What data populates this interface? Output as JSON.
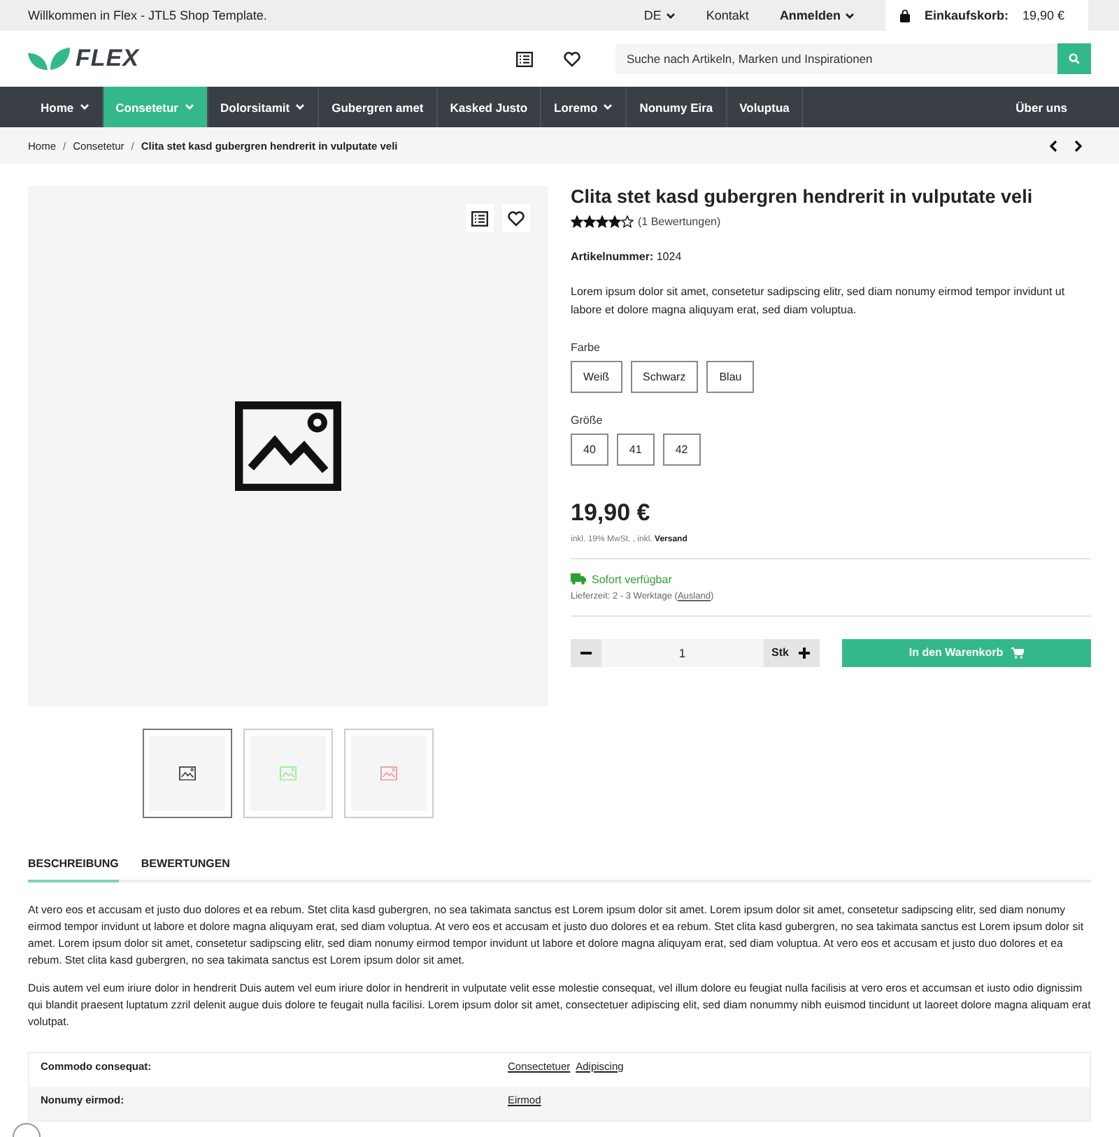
{
  "topbar": {
    "welcome": "Willkommen in Flex - JTL5 Shop Template.",
    "language": "DE",
    "contact": "Kontakt",
    "login": "Anmelden",
    "cart_label": "Einkaufskorb:",
    "cart_total": "19,90 €"
  },
  "header": {
    "logo": "FLEX",
    "search": {
      "placeholder": "Suche nach Artikeln, Marken und Inspirationen"
    }
  },
  "nav": {
    "items": [
      {
        "label": "Home",
        "dropdown": true,
        "selected": false
      },
      {
        "label": "Consetetur",
        "dropdown": true,
        "selected": true
      },
      {
        "label": "Dolorsitamit",
        "dropdown": true,
        "selected": false
      },
      {
        "label": "Gubergren amet",
        "dropdown": false,
        "selected": false
      },
      {
        "label": "Kasked Justo",
        "dropdown": false,
        "selected": false
      },
      {
        "label": "Loremo",
        "dropdown": true,
        "selected": false
      },
      {
        "label": "Nonumy Eira",
        "dropdown": false,
        "selected": false
      },
      {
        "label": "Voluptua",
        "dropdown": false,
        "selected": false
      }
    ],
    "right": "Über uns"
  },
  "breadcrumb": [
    {
      "label": "Home"
    },
    {
      "separator": "/",
      "label": "Consetetur"
    },
    {
      "separator": "/",
      "label": "Clita stet kasd gubergren hendrerit in vulputate veli"
    }
  ],
  "gallery": {
    "thumbs": [
      {
        "color": "#444444",
        "selected": true
      },
      {
        "color": "#99ee99",
        "selected": false
      },
      {
        "color": "#f19999",
        "selected": false
      }
    ]
  },
  "product": {
    "title": "Clita stet kasd gubergren hendrerit in vulputate veli",
    "stars": 4,
    "reviews": "(1 Bewertungen)",
    "sku_label": "Artikelnummer:",
    "sku": "1024",
    "short_description": "Lorem ipsum dolor sit amet, consetetur sadipscing elitr, sed diam nonumy eirmod tempor invidunt ut labore et dolore magna aliquyam erat, sed diam voluptua.",
    "variations": [
      {
        "label": "Farbe",
        "options": [
          "Weiß",
          "Schwarz",
          "Blau"
        ]
      },
      {
        "label": "Größe",
        "options": [
          "40",
          "41",
          "42"
        ]
      }
    ],
    "price": "19,90 €",
    "tax_note": "inkl. 19% MwSt. , inkl.",
    "shipping_link": "Versand",
    "availability": "Sofort verfügbar",
    "delivery": {
      "text": "Lieferzeit: 2 - 3 Werktage (",
      "link": "Ausland",
      "suffix": ")"
    },
    "quantity": "1",
    "unit": "Stk",
    "add_to_cart": "In den Warenkorb"
  },
  "tabs": [
    {
      "label": "BESCHREIBUNG",
      "selected": true
    },
    {
      "label": "BEWERTUNGEN",
      "selected": false
    }
  ],
  "description": [
    "At vero eos et accusam et justo duo dolores et ea rebum. Stet clita kasd gubergren, no sea takimata sanctus est Lorem ipsum dolor sit amet. Lorem ipsum dolor sit amet, consetetur sadipscing elitr, sed diam nonumy eirmod tempor invidunt ut labore et dolore magna aliquyam erat, sed diam voluptua. At vero eos et accusam et justo duo dolores et ea rebum. Stet clita kasd gubergren, no sea takimata sanctus est Lorem ipsum dolor sit amet. Lorem ipsum dolor sit amet, consetetur sadipscing elitr, sed diam nonumy eirmod tempor invidunt ut labore et dolore magna aliquyam erat, sed diam voluptua. At vero eos et accusam et justo duo dolores et ea rebum. Stet clita kasd gubergren, no sea takimata sanctus est Lorem ipsum dolor sit amet.",
    "Duis autem vel eum iriure dolor in hendrerit Duis autem vel eum iriure dolor in hendrerit in vulputate velit esse molestie consequat, vel illum dolore eu feugiat nulla facilisis at vero eros et accumsan et iusto odio dignissim qui blandit praesent luptatum zzril delenit augue duis dolore te feugait nulla facilisi. Lorem ipsum dolor sit amet, consectetuer adipiscing elit, sed diam nonummy nibh euismod tincidunt ut laoreet dolore magna aliquam erat volutpat."
  ],
  "attributes": [
    {
      "name": "Commodo consequat:",
      "values": [
        "Consectetuer",
        "Adipiscing"
      ]
    },
    {
      "name": "Nonumy eirmod:",
      "values": [
        "Eirmod"
      ]
    }
  ]
}
